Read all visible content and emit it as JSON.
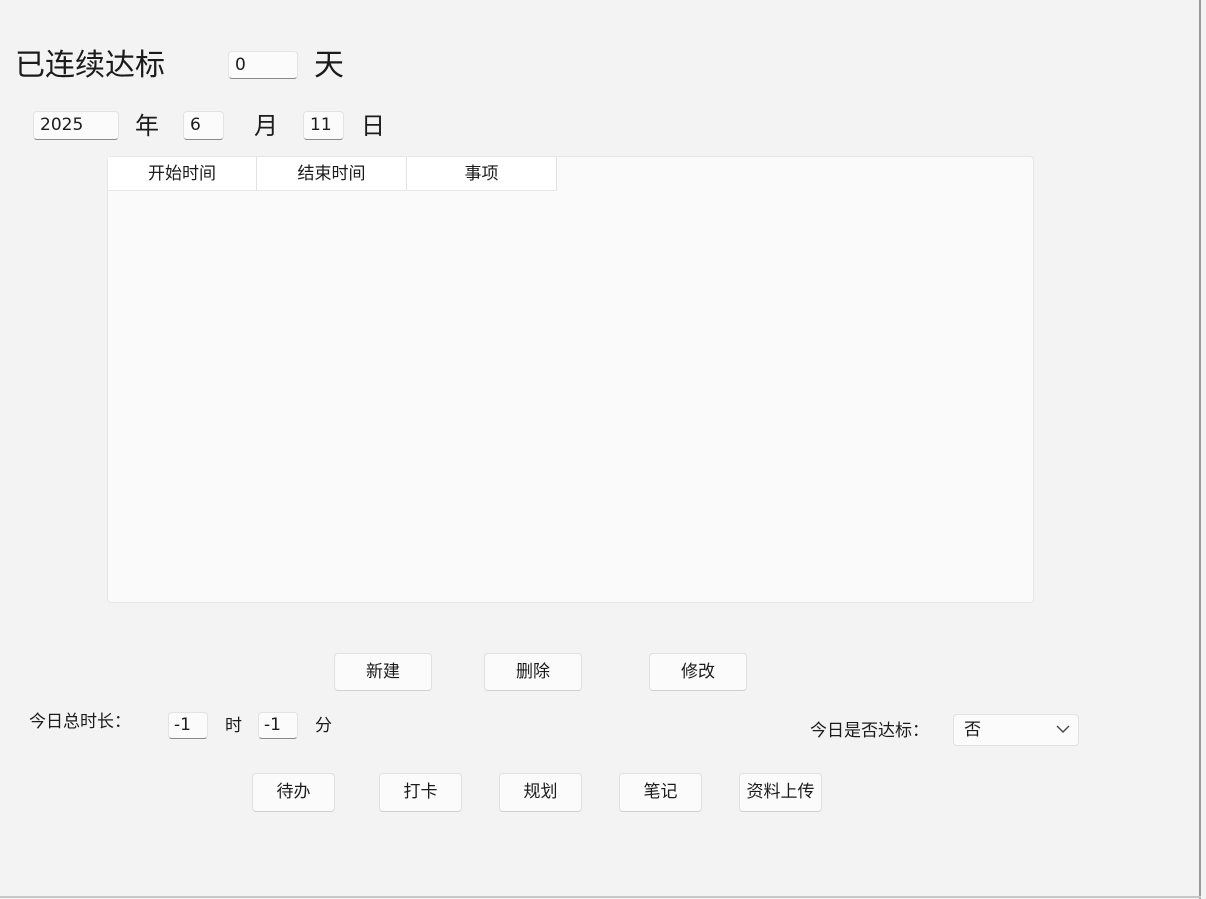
{
  "streak": {
    "label": "已连续达标",
    "value": "0",
    "unit": "天"
  },
  "date": {
    "year": "2025",
    "year_label": "年",
    "month": "6",
    "month_label": "月",
    "day": "11",
    "day_label": "日"
  },
  "table": {
    "columns": [
      "开始时间",
      "结束时间",
      "事项"
    ],
    "rows": []
  },
  "actions": {
    "new_label": "新建",
    "delete_label": "删除",
    "edit_label": "修改"
  },
  "total": {
    "label": "今日总时长：",
    "hours": "-1",
    "hours_label": "时",
    "minutes": "-1",
    "minutes_label": "分"
  },
  "achieved": {
    "label": "今日是否达标：",
    "selected": "否",
    "icon": "chevron-down-icon"
  },
  "nav": {
    "todo_label": "待办",
    "checkin_label": "打卡",
    "plan_label": "规划",
    "notes_label": "笔记",
    "upload_label": "资料上传"
  }
}
